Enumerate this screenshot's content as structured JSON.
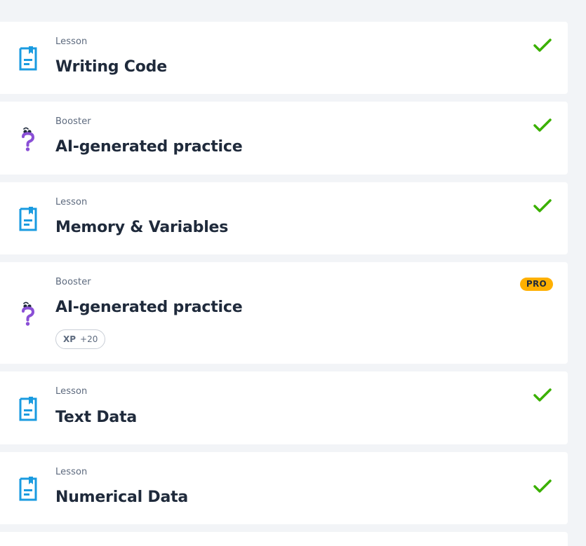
{
  "colors": {
    "background": "#f2f4f7",
    "card": "#ffffff",
    "lesson_icon": "#1a9be0",
    "booster_icon": "#8a4fd6",
    "check": "#3ab000",
    "pro_badge": "#ffb000",
    "title_text": "#1f2a3b",
    "type_text": "#5d6a7e"
  },
  "items": [
    {
      "type": "Lesson",
      "title": "Writing Code",
      "icon": "lesson-document-icon",
      "status": "completed"
    },
    {
      "type": "Booster",
      "title": "AI-generated practice",
      "icon": "booster-question-icon",
      "status": "completed"
    },
    {
      "type": "Lesson",
      "title": "Memory & Variables",
      "icon": "lesson-document-icon",
      "status": "completed"
    },
    {
      "type": "Booster",
      "title": "AI-generated practice",
      "icon": "booster-question-icon",
      "status": "locked",
      "badge": "PRO",
      "xp_label": "XP",
      "xp_value": "+20"
    },
    {
      "type": "Lesson",
      "title": "Text Data",
      "icon": "lesson-document-icon",
      "status": "completed"
    },
    {
      "type": "Lesson",
      "title": "Numerical Data",
      "icon": "lesson-document-icon",
      "status": "completed"
    }
  ]
}
